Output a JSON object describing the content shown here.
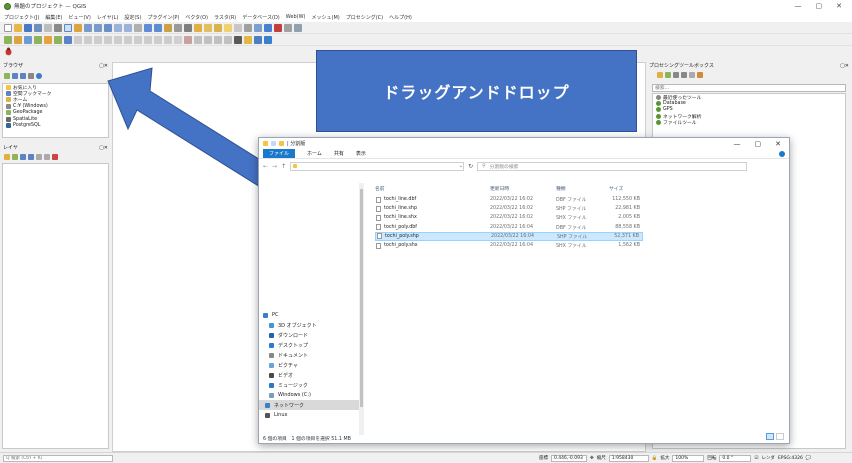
{
  "window": {
    "title": "無題のプロジェクト — QGIS",
    "minimize": "—",
    "maximize": "▢",
    "close": "✕"
  },
  "menu": [
    "プロジェクト(J)",
    "編集(E)",
    "ビュー(V)",
    "レイヤ(L)",
    "設定(S)",
    "プラグイン(P)",
    "ベクタ(O)",
    "ラスタ(R)",
    "データベース(D)",
    "Web(W)",
    "メッシュ(M)",
    "プロセシング(C)",
    "ヘルプ(H)"
  ],
  "browser": {
    "title": "ブラウザ",
    "items": [
      "お気に入り",
      "空間ブックマーク",
      "ホーム",
      "C:¥ (Windows)",
      "GeoPackage",
      "SpatiaLite",
      "PostgreSQL"
    ]
  },
  "layers": {
    "title": "レイヤ"
  },
  "processing": {
    "title": "プロセシングツールボックス",
    "search_placeholder": "検索...",
    "items": [
      "最近使ったツール",
      "Database",
      "GPS",
      "ネットワーク解析",
      "ファイルツール"
    ]
  },
  "explorer": {
    "title": "| 分割版",
    "ribbon_tabs": [
      "ファイル",
      "ホーム",
      "共有",
      "表示"
    ],
    "search_placeholder": "分割版の検索",
    "columns": [
      "名前",
      "更新日時",
      "種類",
      "サイズ"
    ],
    "files": [
      {
        "name": "tochi_line.dbf",
        "date": "2022/03/22 16:02",
        "type": "DBF ファイル",
        "size": "112,550 KB"
      },
      {
        "name": "tochi_line.shp",
        "date": "2022/03/22 16:02",
        "type": "SHP ファイル",
        "size": "22,981 KB"
      },
      {
        "name": "tochi_line.shx",
        "date": "2022/03/22 16:02",
        "type": "SHX ファイル",
        "size": "2,005 KB"
      },
      {
        "name": "tochi_poly.dbf",
        "date": "2022/03/22 16:04",
        "type": "DBF ファイル",
        "size": "88,558 KB"
      },
      {
        "name": "tochi_poly.shp",
        "date": "2022/03/22 16:04",
        "type": "SHP ファイル",
        "size": "52,371 KB"
      },
      {
        "name": "tochi_poly.shx",
        "date": "2022/03/22 16:04",
        "type": "SHX ファイル",
        "size": "1,562 KB"
      }
    ],
    "nav": [
      "PC",
      "3D オブジェクト",
      "ダウンロード",
      "デスクトップ",
      "ドキュメント",
      "ピクチャ",
      "ビデオ",
      "ミュージック",
      "Windows (C:)",
      "ネットワーク",
      "Linux"
    ],
    "status": "6 個の項目　1 個の項目を選択  51.1 MB"
  },
  "callout": {
    "text": "ドラッグアンドドロップ"
  },
  "status_bar": {
    "locate_placeholder": "Q 検索 (Ctrl + K)",
    "coord_label": "座標",
    "coord": "0.446,-0.093",
    "scale_label": "縮尺",
    "scale": "1:958430",
    "magnifier_label": "拡大",
    "magnifier": "100%",
    "rotation_label": "回転",
    "rotation": "0.0 °",
    "render_label": "レンダ",
    "crs": "EPSG:4326"
  },
  "colors": {
    "accent": "#4472c4",
    "qgis_green": "#589632",
    "selection": "#cce8ff",
    "folder": "#f4c542"
  }
}
